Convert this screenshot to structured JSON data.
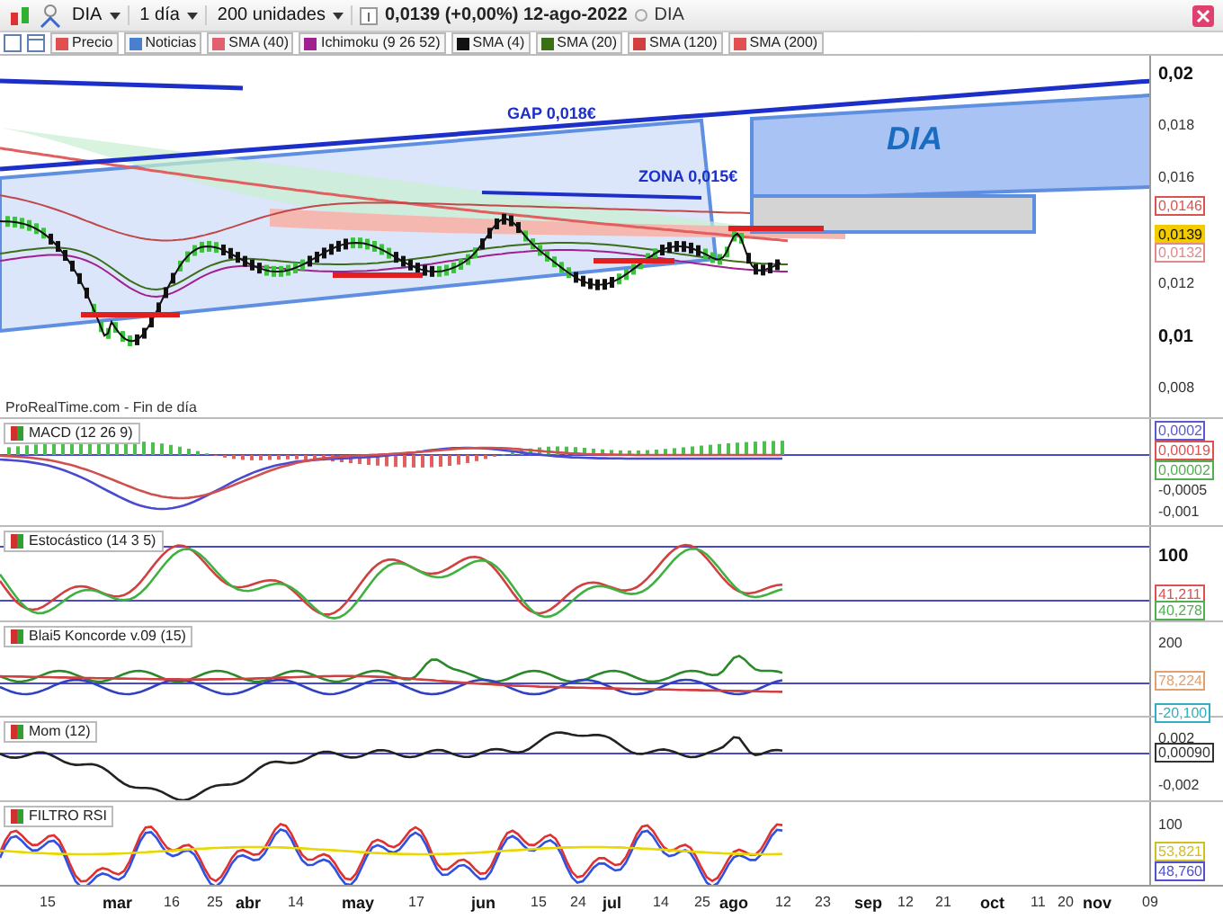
{
  "toolbar": {
    "symbol": "DIA",
    "period": "1 día",
    "units": "200 unidades",
    "quote": "0,0139 (+0,00%) 12-ago-2022",
    "name": "DIA"
  },
  "legend": [
    {
      "label": "Precio",
      "color": "#e05050"
    },
    {
      "label": "Noticias",
      "color": "#4a7fd0"
    },
    {
      "label": "SMA (40)",
      "color": "#e06070"
    },
    {
      "label": "Ichimoku (9 26 52)",
      "color": "#a0208f"
    },
    {
      "label": "SMA (4)",
      "color": "#111111"
    },
    {
      "label": "SMA (20)",
      "color": "#3c6e18"
    },
    {
      "label": "SMA (120)",
      "color": "#d04040"
    },
    {
      "label": "SMA (200)",
      "color": "#e05050"
    }
  ],
  "main": {
    "annotations": [
      {
        "kind": "gap",
        "text": "GAP 0,018€"
      },
      {
        "kind": "zone",
        "text": "ZONA 0,015€"
      },
      {
        "kind": "box",
        "text": "DIA"
      }
    ],
    "source": "ProRealTime.com - Fin de día",
    "axis": [
      {
        "kind": "major",
        "text": "0,02"
      },
      {
        "kind": "tick",
        "text": "0,018"
      },
      {
        "kind": "tick",
        "text": "0,016"
      },
      {
        "kind": "tag",
        "text": "0,0146",
        "color": "#d9534f"
      },
      {
        "kind": "fill",
        "text": "0,0139",
        "color": "#f2cc00"
      },
      {
        "kind": "tag",
        "text": "0,0132",
        "color": "#e08a8a"
      },
      {
        "kind": "tick",
        "text": "0,012"
      },
      {
        "kind": "major",
        "text": "0,01"
      },
      {
        "kind": "tick",
        "text": "0,008"
      }
    ]
  },
  "panels": [
    {
      "kind": "macd",
      "title": "MACD (12 26 9)",
      "axis": [
        {
          "kind": "tag",
          "text": "0,0002",
          "color": "#5a5ad0"
        },
        {
          "kind": "tag",
          "text": "0,00019",
          "color": "#e05050"
        },
        {
          "kind": "tag",
          "text": "0,00002",
          "color": "#50b050"
        },
        {
          "kind": "tick",
          "text": "-0,0005"
        },
        {
          "kind": "tick",
          "text": "-0,001"
        }
      ]
    },
    {
      "kind": "stochastic",
      "title": "Estocástico (14 3 5)",
      "axis": [
        {
          "kind": "major",
          "text": "100"
        },
        {
          "kind": "tag",
          "text": "41,211",
          "color": "#e05050"
        },
        {
          "kind": "tag",
          "text": "40,278",
          "color": "#50b050"
        }
      ]
    },
    {
      "kind": "koncorde",
      "title": "Blai5 Koncorde v.09 (15)",
      "axis": [
        {
          "kind": "tick",
          "text": "200"
        },
        {
          "kind": "tag",
          "text": "78,224",
          "color": "#e0a070"
        },
        {
          "kind": "tag",
          "text": "-20,100",
          "color": "#30b0c0"
        }
      ]
    },
    {
      "kind": "momentum",
      "title": "Mom (12)",
      "axis": [
        {
          "kind": "tick",
          "text": "0,002"
        },
        {
          "kind": "tag",
          "text": "0,00090",
          "color": "#333333"
        },
        {
          "kind": "tick",
          "text": "-0,002"
        }
      ]
    },
    {
      "kind": "rsi",
      "title": "FILTRO RSI",
      "axis": [
        {
          "kind": "tick",
          "text": "100"
        },
        {
          "kind": "tag",
          "text": "53,821",
          "color": "#d0c020"
        },
        {
          "kind": "tag",
          "text": "48,760",
          "color": "#5050d0"
        }
      ]
    }
  ],
  "xaxis": [
    {
      "kind": "day",
      "text": "15"
    },
    {
      "kind": "month",
      "text": "mar"
    },
    {
      "kind": "day",
      "text": "16"
    },
    {
      "kind": "day",
      "text": "25"
    },
    {
      "kind": "month",
      "text": "abr"
    },
    {
      "kind": "day",
      "text": "14"
    },
    {
      "kind": "month",
      "text": "may"
    },
    {
      "kind": "day",
      "text": "17"
    },
    {
      "kind": "month",
      "text": "jun"
    },
    {
      "kind": "day",
      "text": "15"
    },
    {
      "kind": "day",
      "text": "24"
    },
    {
      "kind": "month",
      "text": "jul"
    },
    {
      "kind": "day",
      "text": "14"
    },
    {
      "kind": "day",
      "text": "25"
    },
    {
      "kind": "month",
      "text": "ago"
    },
    {
      "kind": "day",
      "text": "12"
    },
    {
      "kind": "day",
      "text": "23"
    },
    {
      "kind": "month",
      "text": "sep"
    },
    {
      "kind": "day",
      "text": "12"
    },
    {
      "kind": "day",
      "text": "21"
    },
    {
      "kind": "month",
      "text": "oct"
    },
    {
      "kind": "day",
      "text": "11"
    },
    {
      "kind": "day",
      "text": "20"
    },
    {
      "kind": "month",
      "text": "nov"
    },
    {
      "kind": "day",
      "text": "09"
    }
  ]
}
